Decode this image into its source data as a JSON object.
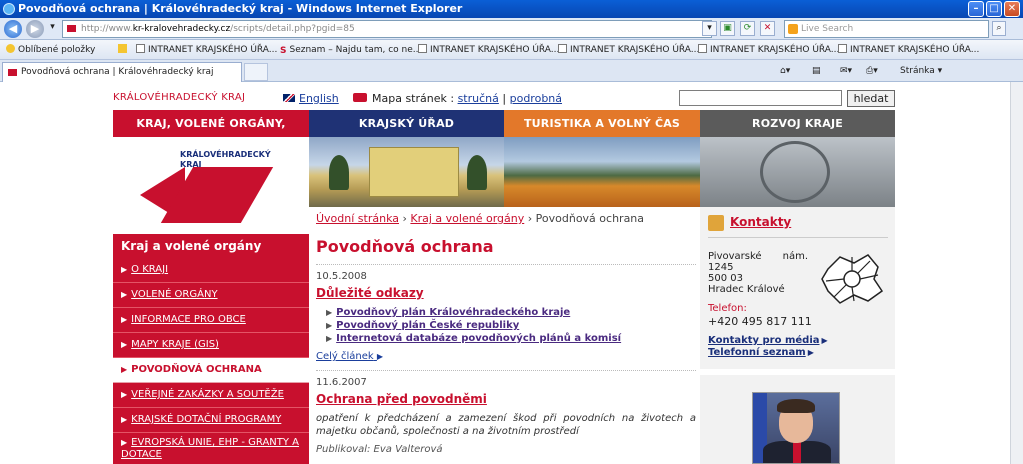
{
  "browser": {
    "window_title": "Povodňová ochrana | Královéhradecký kraj - Windows Internet Explorer",
    "address": {
      "prefix": "http://www.",
      "domain": "kr-kralovehradecky.cz",
      "path": "/scripts/detail.php?pgid=85"
    },
    "search_placeholder": "Live Search",
    "favorites_label": "Oblíbené položky",
    "favorites": [
      "INTRANET KRAJSKÉHO ÚŘA...",
      "Seznam – Najdu tam, co ne...",
      "INTRANET KRAJSKÉHO ÚŘA...",
      "INTRANET KRAJSKÉHO ÚŘA...",
      "INTRANET KRAJSKÉHO ÚŘA...",
      "INTRANET KRAJSKÉHO ÚŘA..."
    ],
    "tab_title": "Povodňová ochrana | Královéhradecký kraj",
    "page_menu": "Stránka ▾"
  },
  "site": {
    "brand": "KRÁLOVÉHRADECKÝ KRAJ",
    "english": "English",
    "sitemap_label": "Mapa stránek :",
    "sitemap_short": "stručná",
    "sitemap_sep": "|",
    "sitemap_detailed": "podrobná",
    "search_button": "hledat",
    "logo_text_1": "KRÁLOVÉHRADECKÝ",
    "logo_text_2": "KRAJ",
    "nav": [
      {
        "label": "KRAJ, VOLENÉ ORGÁNY, DOTACE",
        "color": "#c8102e"
      },
      {
        "label": "KRAJSKÝ ÚŘAD",
        "color": "#1f3275"
      },
      {
        "label": "TURISTIKA A VOLNÝ ČAS",
        "color": "#e3782a"
      },
      {
        "label": "ROZVOJ KRAJE",
        "color": "#5b5b5b"
      }
    ]
  },
  "leftnav": {
    "heading": "Kraj a volené orgány",
    "items": [
      "O KRAJI",
      "VOLENÉ ORGÁNY",
      "INFORMACE PRO OBCE",
      "MAPY KRAJE (GIS)",
      "POVODŇOVÁ OCHRANA",
      "VEŘEJNÉ ZAKÁZKY A SOUTĚŽE",
      "KRAJSKÉ DOTAČNÍ PROGRAMY",
      "EVROPSKÁ UNIE, EHP - GRANTY A DOTACE"
    ]
  },
  "content": {
    "breadcrumb": [
      "Úvodní stránka",
      "Kraj a volené orgány",
      "Povodňová ochrana"
    ],
    "breadcrumb_sep": "›",
    "title": "Povodňová ochrana",
    "articles": [
      {
        "date": "10.5.2008",
        "title": "Důležité odkazy",
        "links": [
          "Povodňový plán Královéhradeckého kraje",
          "Povodňový plán České republiky",
          "Internetová databáze povodňových plánů a komisí"
        ],
        "more": "Celý článek"
      },
      {
        "date": "11.6.2007",
        "title": "Ochrana před povodněmi",
        "excerpt": "opatření k předcházení a zamezení škod při povodních na životech a majetku občanů, společnosti a na životním prostředí",
        "published": "Publikoval: Eva Valterová"
      }
    ]
  },
  "contacts": {
    "heading": "Kontakty",
    "address_street": "Pivovarské",
    "address_street_2": "nám.",
    "address_number": "1245",
    "address_zip": "500 03",
    "address_city": "Hradec Králové",
    "phone_label": "Telefon:",
    "phone": "+420 495 817 111",
    "link_media": "Kontakty pro média",
    "link_phonebook": "Telefonní seznam"
  },
  "colors": {
    "brand_red": "#c8102e",
    "navy": "#1f3275",
    "orange": "#e3782a",
    "grey": "#5b5b5b"
  }
}
